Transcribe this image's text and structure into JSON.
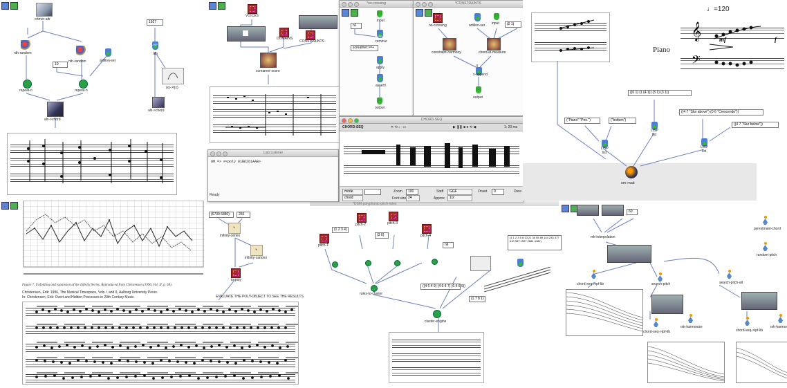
{
  "panel1": {
    "nodes": {
      "chord_seq_mod": "crtmer-aitr",
      "nth_random_a": "nth-random",
      "nth_random_b": "nth-random",
      "artillon_ser": "artillon-ser",
      "repeat_a": "repeat-n",
      "repeat_b": "repeat-n",
      "alo_chord": "alx->chord",
      "const_1927": "1927",
      "const_10": "10",
      "lisp_nth": "nth",
      "lisp_label": "LISP",
      "alx_chord_r": "alx->chord",
      "formula": "(x)->f(x)"
    }
  },
  "panel2": {
    "nodes": {
      "voices": "VOICES",
      "domains": "DOMAINS",
      "constraints": "CONSTRAINTS",
      "screamer_score": "screamer-score"
    }
  },
  "win_crossing": {
    "title": "*no-crossing",
    "input": "input",
    "lisp_label": "LISP",
    "remove": "remove",
    "val_n": "n1",
    "screamer_expr": "screamer:>=+",
    "apply": "apply",
    "assert": "assert!",
    "output": "output"
  },
  "win_constraints": {
    "title": "*CONSTRAINTS",
    "no_crossing": "no-crossing",
    "artillon_ser": "artillon-ser",
    "input": "input",
    "list_01": "(0 1)",
    "constraint_harmony": "constraint-harmony",
    "chord_at_measure": "chord-at-measure",
    "x_append": "x-append",
    "lisp_lt": "((",
    "output": "output"
  },
  "listener": {
    "title": "Lisp Listener",
    "line": "OM => #<poly 81BD261AAB>",
    "status": "Ready"
  },
  "chordseq": {
    "title": "CHORD-SEQ",
    "toolbar_label": "CHORD-SEQ",
    "zoom_readout": "1: 20 ms",
    "fields": {
      "mode": "mode",
      "mode2": "chord",
      "zoom_label": "Zoom",
      "zoom_val": "100",
      "font_label": "Font size",
      "font_val": "24",
      "staff_label": "Staff",
      "staff_val": "GGF",
      "approx_label": "Approx",
      "approx_val": "1/2",
      "onset_label": "Onset",
      "onset_val": "0",
      "dur_label": "Dura"
    }
  },
  "panel5": {
    "tempo": "♩=120",
    "instrument": "Piano",
    "dyn_mf": "mf",
    "dyn_f": "f",
    "list_a": "((0 1) (1 (4 1)) (3 1) (3 1))",
    "list_names": "(\"Piano\" \"Pno.\")",
    "list_bottom": "(\"bottom\")",
    "list_slur": "((4 7 \"Slur above\") (0 6 \"Crescendo\"))",
    "list_slur2": "((4 7 \"Slur below\"))",
    "lisp1": "LISP",
    "list1_label": "list",
    "lisp2": "LISP",
    "list2_label": "list",
    "lisp3": "LISP",
    "list3_label": "list",
    "omi_label": "om->xab"
  },
  "panel6": {
    "val_a": "(6700 6880)",
    "val_b": "256",
    "infinity_series": "infinity-series",
    "infinity_canons": "infinity-canons",
    "to_poly": "to-poly",
    "evaluate_note": "EVALUATE THE POLY-OBJECT TO SEE THE RESULTS.",
    "caption": "Figure 7. Unfolding and expansion of the Infinity Series. Reproduced from Christensen (1996, Vol. II, p. 58).",
    "ref1": "Christensen, Erik: 1996, The Musical Timespace, Vols. I and II, Aalborg University Press.",
    "ref2": "In: Christensen, Erik: Overt and Hidden Processes in 20th Century Music."
  },
  "panel7": {
    "title": "*DSM-polyphonic-pitch-rules",
    "nodes": {
      "pitch_a": "pitch-1",
      "pitch_b": "pitch-2",
      "pitch_c": "pitch-3",
      "pitch_d": "pitch-4",
      "rules_to_cluster": "rules-to-cluster",
      "cluster_engine": "cluster-engine",
      "voice_list": "(1 2 3 4)",
      "rnd": "(3 6)",
      "val_nil": "nil",
      "list_big": "(1 1 2 3 5 8 13 21 34 55 89 144 233 377 610 987 1597 2584 4181)",
      "list_mid": "((4 6 4 9) (4 9 4 7) (6 4 6 9))",
      "btn_label": "(1 7 8 1)"
    }
  },
  "panel8": {
    "nodes": {
      "val": "60",
      "interpolation": "mk-interpolation",
      "chord_seq_tpf": "chord-seq->tpf-lib",
      "search_pitch": "search-pitch",
      "search_pitch_all": "search-pitch-all",
      "polyrest": "pyrestmant-chord",
      "random_pitch": "random-pitch",
      "chord_seq_tpf2": "chord-seq->tpf-lib",
      "mk_harmony": "mk-harmonize",
      "chord_seq_tpf3": "chord-seq->tpf-lib",
      "mk_harm2": "mk-harmonize"
    }
  },
  "colors": {
    "inlet": "#3457d8",
    "lisp_box": "#4a7fd1",
    "green_node": "#2aa048",
    "class_box": "#a52a2a"
  }
}
